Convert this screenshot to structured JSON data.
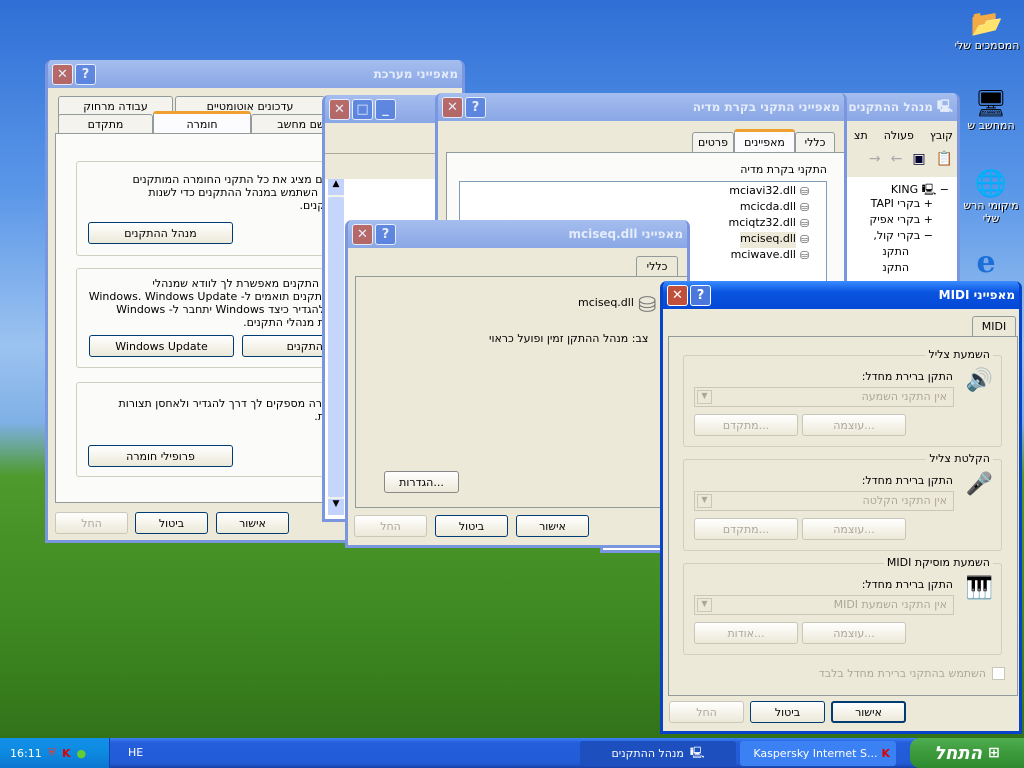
{
  "desktop": {
    "icons": [
      {
        "label": "המסמכים שלי",
        "icon": "folder-icon"
      },
      {
        "label": "המחשב ש",
        "icon": "computer-icon"
      },
      {
        "label": "מיקומי הרש",
        "label2": "שלי",
        "icon": "network-icon"
      },
      {
        "label": "",
        "icon": "internet-explorer-icon"
      }
    ]
  },
  "device_manager": {
    "title": "מנהל ההתקנים",
    "menu": [
      "קובץ",
      "פעולה",
      "תצ"
    ],
    "tree": [
      {
        "label": "KING",
        "toggle": "−"
      },
      {
        "label": "בקרי TAPI",
        "toggle": "+"
      },
      {
        "label": "בקרי אפיק",
        "toggle": "+"
      },
      {
        "label": "בקרי קול,",
        "toggle": "−"
      },
      {
        "label": "התקנ"
      },
      {
        "label": "התקנ"
      }
    ]
  },
  "system_properties": {
    "title": "מאפייני מערכת",
    "tabs_row1": [
      "עבודה מרחוק",
      "עדכונים אוטומטיים"
    ],
    "tabs_row2": [
      "מתקדם",
      "חומרה",
      "שם מחשב"
    ],
    "selected_tab": "חומרה",
    "groups": [
      {
        "lines": [
          "ים מציג את כל התקני החומרה המותקנים",
          ". השתמש במנהל ההתקנים כדי לשנות",
          "קנים."
        ],
        "buttons": [
          "מנהל ההתקנים"
        ]
      },
      {
        "lines": [
          "י התקנים מאפשרת לך לוודא שמנהלי",
          "ותקנים תואמים ל- Windows. Windows Update",
          "להגדיר כיצד Windows יתחבר ל- Windows",
          "ת מנהלי התקנים."
        ],
        "buttons": [
          "Windows Update",
          "חלי התקנים"
        ]
      },
      {
        "lines": [
          "ורה מספקים לך דרך להגדיר ולאחסן תצורות",
          "ת."
        ],
        "buttons": [
          "פרופילי חומרה"
        ]
      }
    ],
    "ok": "אישור",
    "cancel": "ביטול",
    "apply": "החל"
  },
  "media_properties": {
    "title": "מאפייני התקני בקרת מדיה",
    "tabs": [
      "כללי",
      "מאפיינים",
      "פרטים"
    ],
    "selected_tab": "מאפיינים",
    "list_label": "התקני בקרת מדיה",
    "items": [
      "mciavi32.dll",
      "mcicda.dll",
      "mciqtz32.dll",
      "mciseq.dll",
      "mciwave.dll"
    ],
    "selected_item": "mciseq.dll"
  },
  "mciseq": {
    "title": "מאפייני mciseq.dll",
    "tab": "כללי",
    "name": "mciseq.dll",
    "status": "צב: מנהל ההתקן זמין ופועל כראוי",
    "settings": "הגדרות...",
    "ok": "אישור",
    "cancel": "ביטול",
    "apply": "החל"
  },
  "midi": {
    "title": "מאפייני MIDI",
    "tab": "MIDI",
    "groups": [
      {
        "title": "השמעת צליל",
        "label": "התקן ברירת מחדל:",
        "value": "אין התקני השמעה",
        "buttons": [
          "מתקדם...",
          "עוצמה..."
        ],
        "icon": "speaker-icon"
      },
      {
        "title": "הקלטת צליל",
        "label": "התקן ברירת מחדל:",
        "value": "אין התקני הקלטה",
        "buttons": [
          "מתקדם...",
          "עוצמה..."
        ],
        "icon": "microphone-icon"
      },
      {
        "title": "השמעת מוסיקת MIDI",
        "label": "התקן ברירת מחדל:",
        "value": "אין התקני השמעת MIDI",
        "buttons": [
          "אודות...",
          "עוצמה..."
        ],
        "icon": "midi-keyboard-icon"
      }
    ],
    "checkbox": "השתמש בהתקני ברירת מחדל בלבד",
    "checked": false,
    "ok": "אישור",
    "cancel": "ביטול",
    "apply": "החל"
  },
  "taskbar": {
    "start": "התחל",
    "tasks": [
      {
        "label": "Kaspersky Internet S...",
        "icon": "kaspersky-icon"
      },
      {
        "label": "מנהל ההתקנים",
        "icon": "device-manager-icon",
        "active": true
      }
    ],
    "lang": "HE",
    "clock": "16:11"
  }
}
